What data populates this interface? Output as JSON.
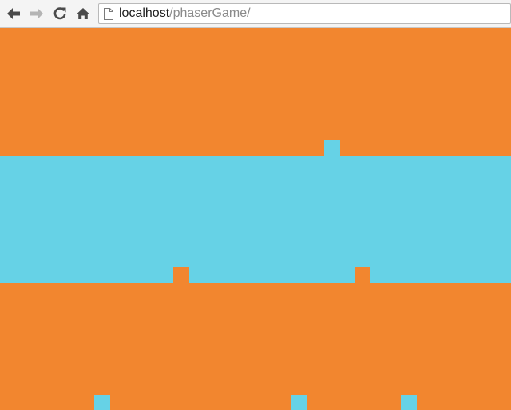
{
  "browser": {
    "address_bar": {
      "url_host": "localhost",
      "url_path": "/phaserGame/"
    },
    "buttons": {
      "back": "back-arrow-icon",
      "forward": "forward-arrow-icon",
      "reload": "reload-icon",
      "home": "home-icon"
    }
  },
  "game": {
    "colors": {
      "orange": "#f2862f",
      "cyan": "#66d2e6"
    },
    "bands": [
      {
        "color": "orange"
      },
      {
        "color": "cyan"
      },
      {
        "color": "orange"
      }
    ],
    "blocks": [
      {
        "band": 0,
        "color": "cyan"
      },
      {
        "band": 1,
        "color": "orange"
      },
      {
        "band": 1,
        "color": "orange"
      },
      {
        "band": 2,
        "color": "cyan"
      },
      {
        "band": 2,
        "color": "cyan"
      },
      {
        "band": 2,
        "color": "cyan"
      }
    ]
  }
}
